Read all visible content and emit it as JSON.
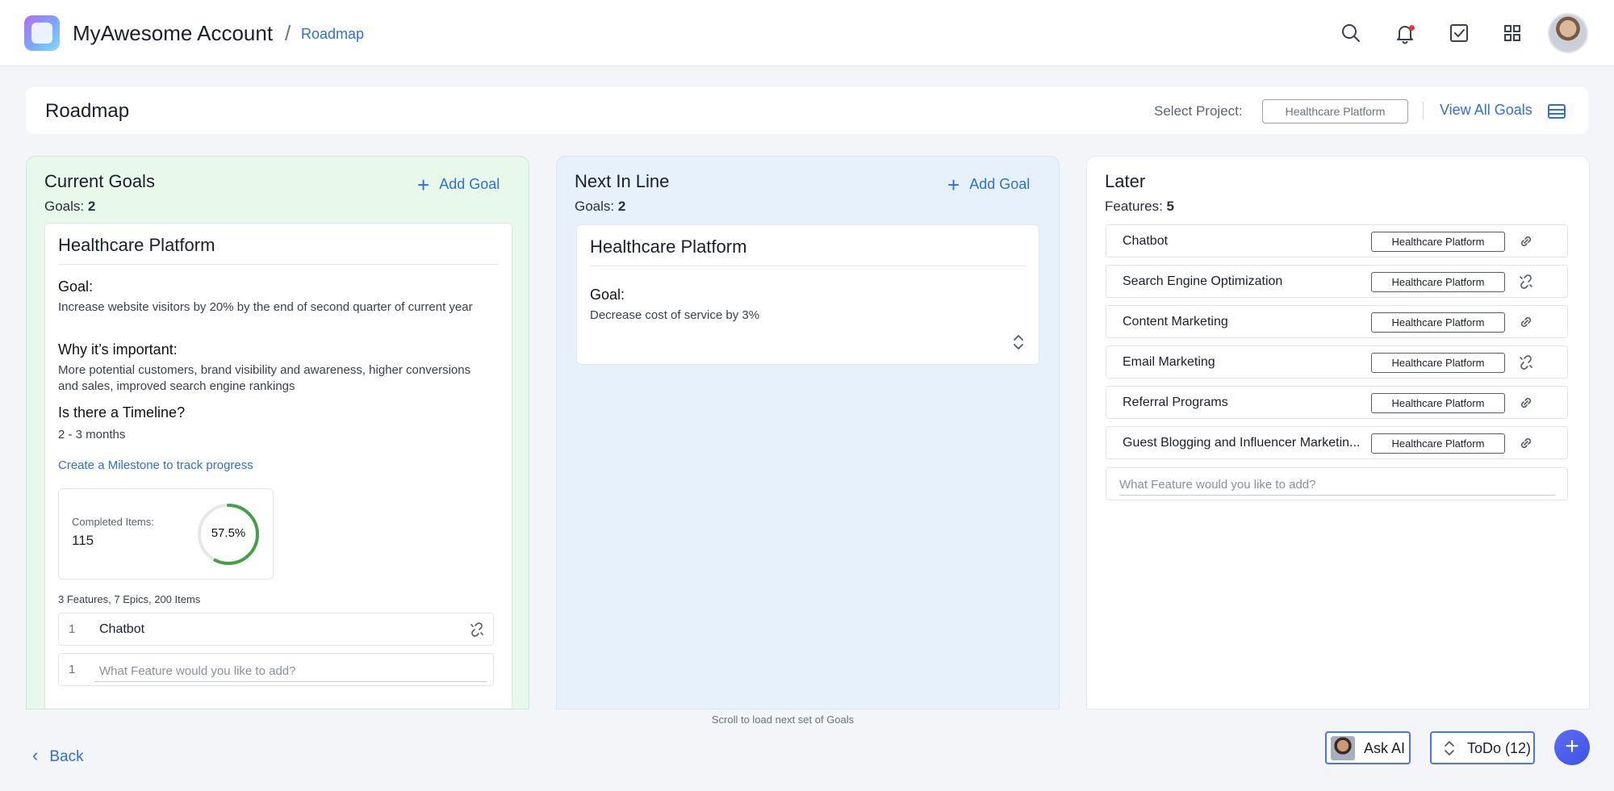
{
  "topbar": {
    "account_name": "MyAwesome Account",
    "separator": "/",
    "breadcrumb": "Roadmap"
  },
  "header": {
    "title": "Roadmap",
    "select_label": "Select Project:",
    "project_value": "Healthcare Platform",
    "view_all_label": "View All Goals"
  },
  "current_goals": {
    "title": "Current Goals",
    "add_label": "Add Goal",
    "count_label": "Goals:",
    "count": "2",
    "card": {
      "title": "Healthcare Platform",
      "goal_label": "Goal:",
      "goal_text": "Increase website visitors by 20% by the end of second quarter of current year",
      "why_label": "Why it’s important:",
      "why_text": "More potential customers, brand visibility and awareness, higher conversions and sales, improved search engine rankings",
      "timeline_label": "Is there a Timeline?",
      "timeline_text": "2 - 3 months",
      "milestone_link": "Create a Milestone to track progress",
      "completed_label": "Completed Items:",
      "completed_value": "115",
      "progress_text": "57.5%",
      "progress_fraction": 0.575,
      "meta": "3 Features, 7 Epics, 200 Items",
      "features": [
        {
          "num": "1",
          "name": "Chatbot"
        }
      ],
      "add_feature_num": "1",
      "add_feature_placeholder": "What Feature would you like to add?"
    }
  },
  "next_in_line": {
    "title": "Next In Line",
    "add_label": "Add Goal",
    "count_label": "Goals:",
    "count": "2",
    "card": {
      "title": "Healthcare Platform",
      "goal_label": "Goal:",
      "goal_text": "Decrease cost of service by 3%"
    }
  },
  "later": {
    "title": "Later",
    "count_label": "Features:",
    "count": "5",
    "items": [
      {
        "name": "Chatbot",
        "tag": "Healthcare Platform",
        "linked": true
      },
      {
        "name": "Search Engine Optimization",
        "tag": "Healthcare Platform",
        "linked": false
      },
      {
        "name": "Content Marketing",
        "tag": "Healthcare Platform",
        "linked": true
      },
      {
        "name": "Email Marketing",
        "tag": "Healthcare Platform",
        "linked": false
      },
      {
        "name": "Referral Programs",
        "tag": "Healthcare Platform",
        "linked": true
      },
      {
        "name": "Guest Blogging and Influencer Marketin...",
        "tag": "Healthcare Platform",
        "linked": true
      }
    ],
    "add_placeholder": "What Feature would you like to add?"
  },
  "footer": {
    "scroll_hint": "Scroll to load next set of Goals",
    "back_label": "Back",
    "ask_ai_label": "Ask AI",
    "todo_label": "ToDo (12)",
    "fab_label": "+"
  },
  "colors": {
    "accent": "#2f6fd6",
    "current_bg": "#e8f8ea",
    "next_bg": "#e6f1fb",
    "progress": "#43a047"
  },
  "icons": {
    "search": "search-icon",
    "notifications": "bell-icon",
    "tasks": "checkbox-icon",
    "apps": "grid-icon",
    "view_all": "list-icon",
    "feature_link": "link-icon",
    "expand": "chevron-up-down-icon"
  }
}
